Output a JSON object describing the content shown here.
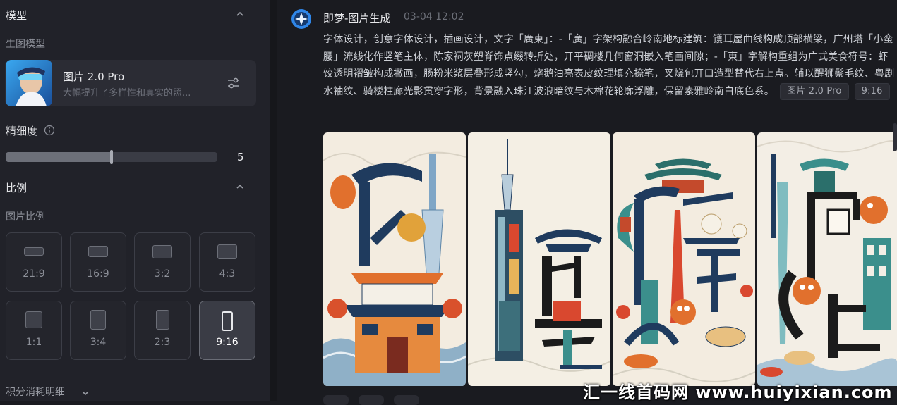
{
  "left_panel": {
    "model_section_title": "模型",
    "model_sub_label": "生图模型",
    "model": {
      "name": "图片 2.0 Pro",
      "description": "大幅提升了多样性和真实的照..."
    },
    "detail_title": "精细度",
    "detail_value": "5",
    "detail_level": 0.5,
    "ratio_section_title": "比例",
    "ratio_sub_label": "图片比例",
    "ratios": [
      {
        "label": "21:9",
        "selected": false
      },
      {
        "label": "16:9",
        "selected": false
      },
      {
        "label": "3:2",
        "selected": false
      },
      {
        "label": "4:3",
        "selected": false
      },
      {
        "label": "1:1",
        "selected": false
      },
      {
        "label": "3:4",
        "selected": false
      },
      {
        "label": "2:3",
        "selected": false
      },
      {
        "label": "9:16",
        "selected": true
      }
    ],
    "credits_label": "积分消耗明细"
  },
  "message": {
    "sender": "即梦-图片生成",
    "timestamp": "03-04  12:02",
    "prompt": "字体设计，创意字体设计，插画设计，文字「廣東」：-「廣」字架构融合岭南地标建筑：镬耳屋曲线构成顶部横梁，广州塔「小蛮腰」流线化作竖笔主体，陈家祠灰塑脊饰点缀转折处，开平碉楼几何窗洞嵌入笔画间隙；-「東」字解构重组为广式美食符号：虾饺透明褶皱构成撇画，肠粉米浆层叠形成竖勾，烧鹅油亮表皮纹理填充捺笔，叉烧包开口造型替代右上点。辅以醒狮鬃毛纹、粤剧水袖纹、骑楼柱廊光影贯穿字形，背景融入珠江波浪暗纹与木棉花轮廓浮雕，保留素雅岭南白底色系。",
    "tags": [
      "图片 2.0 Pro",
      "9:16"
    ]
  },
  "watermark": "汇一线首码网 www.huiyixian.com",
  "colors": {
    "panel_bg": "#212229",
    "page_bg": "#1a1b20",
    "accent_blue": "#2f86e8",
    "poster_cream": "#f3ece0",
    "poster_navy": "#1f3b5e",
    "poster_orange": "#e1702d",
    "poster_teal": "#3b8f8c"
  }
}
